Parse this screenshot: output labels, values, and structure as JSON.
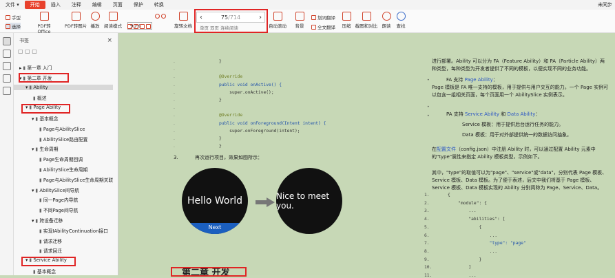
{
  "menubar": {
    "items": [
      "文件",
      "开始",
      "插入",
      "注释",
      "编辑",
      "页面",
      "保护",
      "转换"
    ],
    "file": "文件 ▾",
    "active": "开始",
    "right": "未同步"
  },
  "toolbar": {
    "hand": "手型",
    "select": "选择",
    "pdf_office": "PDF转Office",
    "pdf_image": "PDF转图片",
    "play": "播放",
    "read_mode": "阅读模式",
    "zoom": "90%",
    "rotate": "旋转文档",
    "single": "单页",
    "double": "双页",
    "continuous": "连续阅读",
    "auto_scroll": "自动滚动",
    "background": "背景",
    "translate": "划词翻译",
    "full_translate": "全文翻译",
    "compress": "压缩",
    "screenshot": "截图和对比",
    "read_aloud": "朗读",
    "search": "查找"
  },
  "page_nav": {
    "current": "75",
    "total": "/714",
    "prev": "‹",
    "next": "›"
  },
  "bookmarks": {
    "title": "书签",
    "close": "×",
    "items": [
      {
        "label": "第一章 入门",
        "indent": 0,
        "arrow": "▸"
      },
      {
        "label": "第二章 开发",
        "indent": 0,
        "arrow": "▾"
      },
      {
        "label": "Ability",
        "indent": 1,
        "arrow": "▾"
      },
      {
        "label": "概述",
        "indent": 2,
        "arrow": ""
      },
      {
        "label": "Page Ability",
        "indent": 1,
        "arrow": "▾"
      },
      {
        "label": "基本概念",
        "indent": 2,
        "arrow": "▾"
      },
      {
        "label": "Page与AbilitySlice",
        "indent": 3,
        "arrow": ""
      },
      {
        "label": "AbilitySlice路由配置",
        "indent": 3,
        "arrow": ""
      },
      {
        "label": "生命周期",
        "indent": 2,
        "arrow": "▾"
      },
      {
        "label": "Page生命周期回调",
        "indent": 3,
        "arrow": ""
      },
      {
        "label": "AbilitySlice生命周期",
        "indent": 3,
        "arrow": ""
      },
      {
        "label": "Page与AbilitySlice生命周期关联",
        "indent": 3,
        "arrow": ""
      },
      {
        "label": "AbilitySlice间导航",
        "indent": 2,
        "arrow": "▾"
      },
      {
        "label": "同一Page内导航",
        "indent": 3,
        "arrow": ""
      },
      {
        "label": "不同Page间导航",
        "indent": 3,
        "arrow": ""
      },
      {
        "label": "跨设备迁移",
        "indent": 2,
        "arrow": "▾"
      },
      {
        "label": "实现IAbilityContinuation接口",
        "indent": 3,
        "arrow": ""
      },
      {
        "label": "请求迁移",
        "indent": 3,
        "arrow": ""
      },
      {
        "label": "请求回迁",
        "indent": 3,
        "arrow": ""
      },
      {
        "label": "Service Ability",
        "indent": 1,
        "arrow": "▾"
      },
      {
        "label": "基本概念",
        "indent": 2,
        "arrow": ""
      }
    ]
  },
  "doc_left": {
    "code": [
      "}",
      "",
      "@Override",
      "public void onActive() {",
      "    super.onActive();",
      "}",
      "",
      "@Override",
      "public void onForeground(Intent intent) {",
      "    super.onForeground(intent);",
      "}",
      "}"
    ],
    "step_num": "3.",
    "step_text": "再次运行项目，效果如图所示：",
    "watch1": "Hello World",
    "watch1_btn": "Next",
    "watch2": "Nice to meet you.",
    "heading": "第二章 开发"
  },
  "doc_right": {
    "p1": "进行部署。Ability 可以分为 FA（Feature Ability）和 PA（Particle Ability）两种类型，每种类型为开发者提供了不同的模板，以便实现不同的业务功能。",
    "fa_pre": "FA 支持 ",
    "fa_link": "Page Ability",
    "fa_post": "：",
    "p2": "Page 模板是 FA 唯一支持的模板，用于提供与用户交互的能力。一个 Page 实例可以包含一组相关页面，每个页面用一个 AbilitySlice 实例表示。",
    "pa_pre": "PA 支持 ",
    "pa_link1": "Service Ability",
    "pa_mid": " 和 ",
    "pa_link2": "Data Ability",
    "pa_post": "：",
    "service": "Service 模板：用于提供后台运行任务的能力。",
    "data": "Data 模板：用于对外部提供统一的数据访问抽象。",
    "p3_pre": "在",
    "p3_link": "配置文件",
    "p3_post": "（config.json）中注册 Ability 时，可以通过配置 Ability 元素中的\"type\"属性来指定 Ability 模板类型，示例如下。",
    "p4": "其中，\"type\"的取值可以为\"page\"、\"service\"或\"data\"，分别代表 Page 模板、Service 模板、Data 模板。为了便于表述，后文中我们将基于 Page 模板、Service 模板、Data 模板实现的 Ability 分别简称为 Page、Service、Data。",
    "lines": [
      "1.",
      "2.",
      "3.",
      "4.",
      "5.",
      "6.",
      "7.",
      "8.",
      "9.",
      "10.",
      "11."
    ],
    "json": [
      "{",
      "    \"module\": {",
      "        ...",
      "        \"abilities\": [",
      "            {",
      "                ...",
      "                \"type\": \"page\"",
      "                ...",
      "            }",
      "        ]",
      "        ..."
    ]
  },
  "colors": {
    "accent": "#e8412c",
    "highlight": "#e02424",
    "doc_bg": "#c7d8b6",
    "link": "#2a55c4"
  }
}
